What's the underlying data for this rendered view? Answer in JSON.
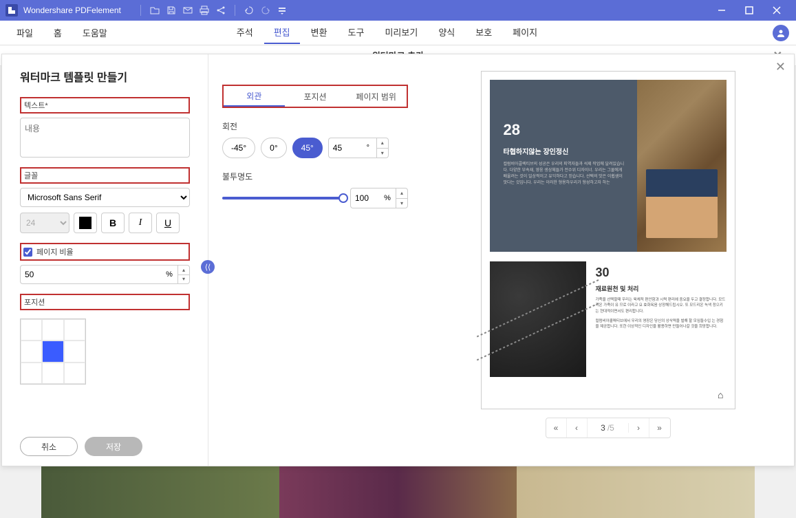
{
  "titlebar": {
    "app_name": "Wondershare PDFelement"
  },
  "menubar": {
    "left": [
      "파일",
      "홈",
      "도움말"
    ],
    "center": [
      "주석",
      "편집",
      "변환",
      "도구",
      "미리보기",
      "양식",
      "보호",
      "페이지"
    ],
    "active_center_index": 1
  },
  "sub_header": {
    "title": "워터마크 추가"
  },
  "dialog": {
    "title": "워터마크 템플릿 만들기",
    "text_label": "텍스트*",
    "text_placeholder": "내용",
    "font_label": "글꼴",
    "font_value": "Microsoft Sans Serif",
    "font_size_value": "24",
    "page_ratio_label": "페이지 비율",
    "page_ratio_value": "50",
    "page_ratio_unit": "%",
    "position_label": "포지션",
    "cancel": "취소",
    "save": "저장"
  },
  "tabs": {
    "items": [
      "외관",
      "포지션",
      "페이지 범위"
    ],
    "active_index": 0
  },
  "rotation": {
    "label": "회전",
    "options": [
      "-45°",
      "0°",
      "45°"
    ],
    "active_index": 2,
    "custom_value": "45",
    "custom_unit": "°"
  },
  "opacity": {
    "label": "불투명도",
    "value": "100",
    "unit": "%"
  },
  "preview": {
    "sec1_num": "28",
    "sec1_title": "타협하지않는 장인정신",
    "sec1_body": "컬럼비아콜렉티브의 성공은 우리의 피역자들과 석제 작업에 달려있습니다. 다양한 부속재, 영웅 생상체들가 전수위 디자이너. 우리는 그물에게 배울려는 것이 일상적이고 유익하다고 믿습니다. 선택의 맛은 이휩샘이 맛다는 것입니다. 우리는 이러한 형용하우리가 형성하고자 하는",
    "sec2_num": "30",
    "sec2_title": "재료원천 및 처리",
    "sec2_body1": "가족을 선택할때 우리는 육체적 편안함과 시력 편리에 중요을 두고 결정합니다. 모드리온 가죽이 유 므로 이라고 요 효화옥음 상장해드립시오. 또 모드리온 녹색 정으키 는 현대적이면서도 편리합니다.",
    "sec2_body2": "컬럼비아콜렉티브에서 우리의 영장은 당신의 상삭력을 벌해 할 모임들수입 는 경험을 제공합니다. 또한 이상적인 디자인을 활용하면 만들어나갈 것을 희망합니다."
  },
  "page_nav": {
    "current": "3",
    "total": "5"
  }
}
